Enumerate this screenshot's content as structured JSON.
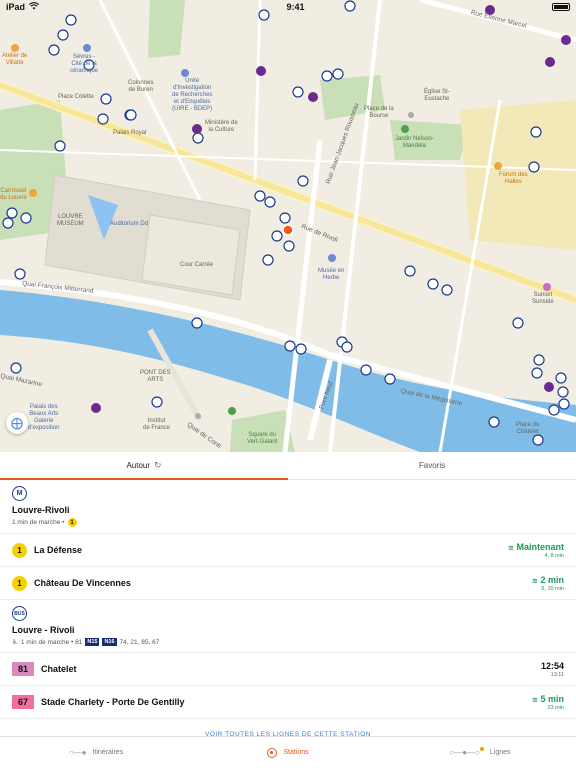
{
  "statusbar": {
    "device": "iPad",
    "time": "9:41",
    "wifi_icon": "wifi-icon",
    "battery_icon": "battery-icon"
  },
  "map": {
    "labels": {
      "atelier": "Atelier de\nVillatte",
      "sevres": "Sèvres -\nCité de la\ncéramique",
      "colette": "Place Colette",
      "buren": "Colonnes\nde Buren",
      "palais_royal": "Palais Royal",
      "unite": "Unité\nd'Investigation\nde Recherches\net d'Enquêtes\n(UIRE - BDEP)",
      "culture": "Ministère de\nla Culture",
      "bourse": "Place de la\nBourse",
      "jardin": "Jardin Nelson-\nMandela",
      "eglise": "Église St-\nEustache",
      "forum": "Forum des\nHalles",
      "carrousel": "Carrousel\ndu Louvre",
      "louvre": "LOUVRE\nMUSEUM",
      "auditorium": "Auditorium Dd",
      "cour": "Cour Carrée",
      "rivoli": "Rue de Rivoli",
      "mitterrand": "Quai François Mitterrand",
      "musee_herbe": "Musée en\nHerbe",
      "sunset": "Sunset\nSunside",
      "pont_arts": "PONT DES\nARTS",
      "mazarine": "Quai Mazarine",
      "conti": "Quai de Conti",
      "institut": "Institut\nde France",
      "beaux_arts": "Palais des\nBeaux Arts\nGalerie\nd'exposition",
      "vert_galant": "Square du\nVert-Galant",
      "pont_neuf": "Pont Neuf",
      "megisserie": "Quai de la Mégisserie",
      "chatelet": "Place du\nChâtelet",
      "etienne": "Rue Étienne Marcel",
      "hor": "Rue Jean-Jacques Rousseau"
    },
    "locate_icon": "locate-icon"
  },
  "tabs": [
    {
      "label": "Autour",
      "icon": "refresh-icon"
    },
    {
      "label": "Favoris"
    }
  ],
  "stations": [
    {
      "mode_icon": "metro-icon",
      "mode_letter": "M",
      "name": "Louvre-Rivoli",
      "walk": "1 min de marche •",
      "lines_label": "1",
      "departures": [
        {
          "line": "1",
          "destination": "La Défense",
          "time": "Maintenant",
          "sub": "4, 8 min",
          "live": true
        },
        {
          "line": "1",
          "destination": "Château De Vincennes",
          "time": "2 min",
          "sub": "6, 10 min",
          "live": true
        }
      ]
    },
    {
      "mode_icon": "bus-icon",
      "mode_letter": "BUS",
      "name": "Louvre - Rivoli",
      "walk": "1 min de marche • 81",
      "night_lines": [
        "N15",
        "N16"
      ],
      "other_lines": "74, 21, 85, 67",
      "departures": [
        {
          "line": "81",
          "destination": "Chatelet",
          "time": "12:54",
          "sub": "13:11",
          "live": false,
          "color": "#d98bc0"
        },
        {
          "line": "67",
          "destination": "Stade Charlety - Porte De Gentilly",
          "time": "5 min",
          "sub": "23 min",
          "live": true,
          "color": "#f06fa0"
        }
      ]
    }
  ],
  "more_link": "VOIR TOUTES LES LIGNES DE CETTE STATION",
  "bottomnav": [
    {
      "label": "Itinéraires",
      "icon": "route-icon"
    },
    {
      "label": "Stations",
      "icon": "station-icon"
    },
    {
      "label": "Lignes",
      "icon": "lines-icon"
    }
  ],
  "colors": {
    "accent": "#e25b1e",
    "live": "#1a9b5a",
    "metro1": "#f5d100",
    "ratp_blue": "#1b3b8f"
  }
}
